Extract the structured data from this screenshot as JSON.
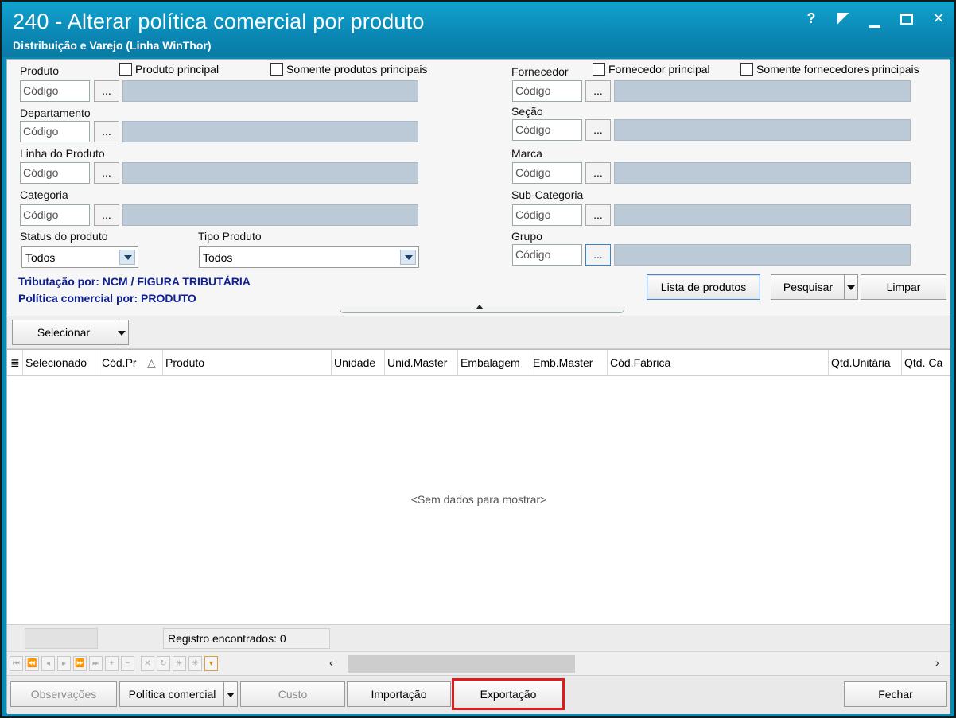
{
  "window": {
    "title": "240 - Alterar política comercial por produto",
    "subtitle": "Distribuição e Varejo (Linha WinThor)",
    "controls": [
      "?",
      "restore",
      "minimize",
      "maximize",
      "close"
    ],
    "help_label": "?",
    "close_label": "✕"
  },
  "filters": {
    "produto_label": "Produto",
    "produto_principal": "Produto principal",
    "somente_produtos_principais": "Somente produtos principais",
    "departamento_label": "Departamento",
    "linha_produto_label": "Linha do Produto",
    "categoria_label": "Categoria",
    "status_label": "Status do produto",
    "status_value": "Todos",
    "tipo_label": "Tipo Produto",
    "tipo_value": "Todos",
    "fornecedor_label": "Fornecedor",
    "fornecedor_principal": "Fornecedor principal",
    "somente_fornecedores_principais": "Somente fornecedores principais",
    "secao_label": "Seção",
    "marca_label": "Marca",
    "subcategoria_label": "Sub-Categoria",
    "grupo_label": "Grupo",
    "code_placeholder": "Código",
    "dots_label": "...",
    "tributacao": "Tributação por: NCM / FIGURA TRIBUTÁRIA",
    "politica": "Política comercial por: PRODUTO"
  },
  "actions": {
    "lista_produtos": "Lista de produtos",
    "pesquisar": "Pesquisar",
    "limpar": "Limpar",
    "selecionar": "Selecionar"
  },
  "grid": {
    "columns": [
      "Selecionado",
      "Cód.Pr",
      "Produto",
      "Unidade",
      "Unid.Master",
      "Embalagem",
      "Emb.Master",
      "Cód.Fábrica",
      "Qtd.Unitária",
      "Qtd. Ca"
    ],
    "sort_glyph": "△",
    "empty_text": "<Sem dados para mostrar>",
    "records_text": "Registro encontrados: 0"
  },
  "bottom": {
    "observacoes": "Observações",
    "politica_comercial": "Política comercial",
    "custo": "Custo",
    "importacao": "Importação",
    "exportacao": "Exportação",
    "fechar": "Fechar"
  },
  "colors": {
    "titlebar": "#0b87b4",
    "info_text": "#0e1f8f",
    "highlight": "#e11a1a"
  }
}
